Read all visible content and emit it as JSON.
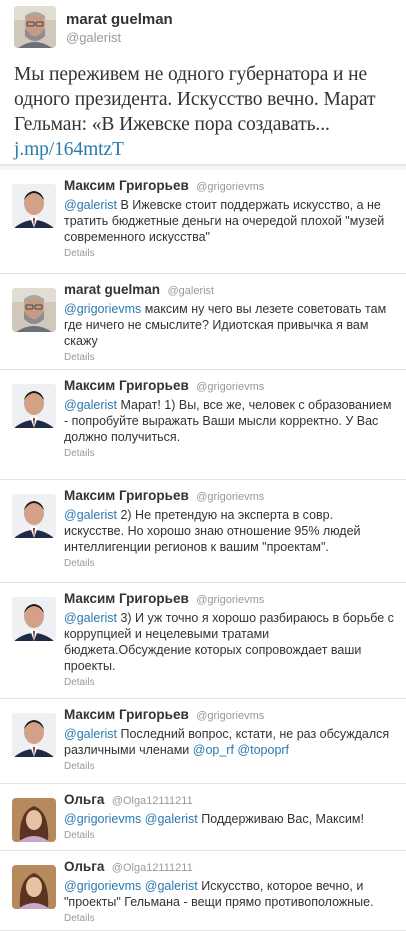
{
  "main_tweet": {
    "fullname": "marat guelman",
    "screen_name": "@galerist",
    "text": "Мы переживем не одного губернатора и не одного президента. Искусство вечно. Марат Гельман: «В Ижевске пора создавать... ",
    "link": "j.mp/164mtzT"
  },
  "replies": [
    {
      "fullname": "Максим Григорьев",
      "screen_name": "@grigorievms",
      "avatar": "man-suit-avatar",
      "mentions": [
        "@galerist"
      ],
      "text": " В Ижевске стоит поддержать искусство, а не тратить бюджетные деньги на очередой плохой \"музей современного искусства\"",
      "details": "Details"
    },
    {
      "fullname": "marat guelman",
      "screen_name": "@galerist",
      "avatar": "man-beard-avatar",
      "mentions": [
        "@grigorievms"
      ],
      "text": " максим ну чего вы лезете советовать там где ничего не смыслите? Идиотская привычка я вам скажу",
      "details": "Details"
    },
    {
      "fullname": "Максим Григорьев",
      "screen_name": "@grigorievms",
      "avatar": "man-suit-avatar",
      "mentions": [
        "@galerist"
      ],
      "text": " Марат! 1) Вы, все же, человек с образованием - попробуйте выражать Ваши мысли корректно. У Вас должно получиться.",
      "details": "Details"
    },
    {
      "fullname": "Максим Григорьев",
      "screen_name": "@grigorievms",
      "avatar": "man-suit-avatar",
      "mentions": [
        "@galerist"
      ],
      "text": " 2) Не претендую на эксперта в совр. искусстве. Но хорошо знаю отношение 95% людей интеллигенции регионов к вашим \"проектам\".",
      "details": "Details"
    },
    {
      "fullname": "Максим Григорьев",
      "screen_name": "@grigorievms",
      "avatar": "man-suit-avatar",
      "mentions": [
        "@galerist"
      ],
      "text": " 3) И уж точно я хорошо разбираюсь в борьбе с коррупцией и нецелевыми тратами бюджета.Обсуждение которых сопровождает ваши проекты.",
      "details": "Details"
    },
    {
      "fullname": "Максим Григорьев",
      "screen_name": "@grigorievms",
      "avatar": "man-suit-avatar",
      "mentions": [
        "@galerist"
      ],
      "text_before": " Последний вопрос, кстати, не раз обсуждался различными членами ",
      "mention_a": "@op_rf",
      "text_mid": " ",
      "mention_b": "@topoprf",
      "details": "Details"
    },
    {
      "fullname": "Ольга",
      "screen_name": "@Olga12111211",
      "avatar": "woman-avatar",
      "mentions": [
        "@grigorievms",
        "@galerist"
      ],
      "text": " Поддерживаю Вас, Максим!",
      "details": "Details"
    },
    {
      "fullname": "Ольга",
      "screen_name": "@Olga12111211",
      "avatar": "woman-avatar",
      "mentions": [
        "@grigorievms",
        "@galerist"
      ],
      "text": " Искусство, которое вечно, и \"проекты\" Гельмана - вещи прямо противоположные.",
      "details": "Details"
    }
  ],
  "colors": {
    "link": "#2a7ab0",
    "name": "#333333",
    "muted": "#999999",
    "divider": "#e4e4e4"
  }
}
